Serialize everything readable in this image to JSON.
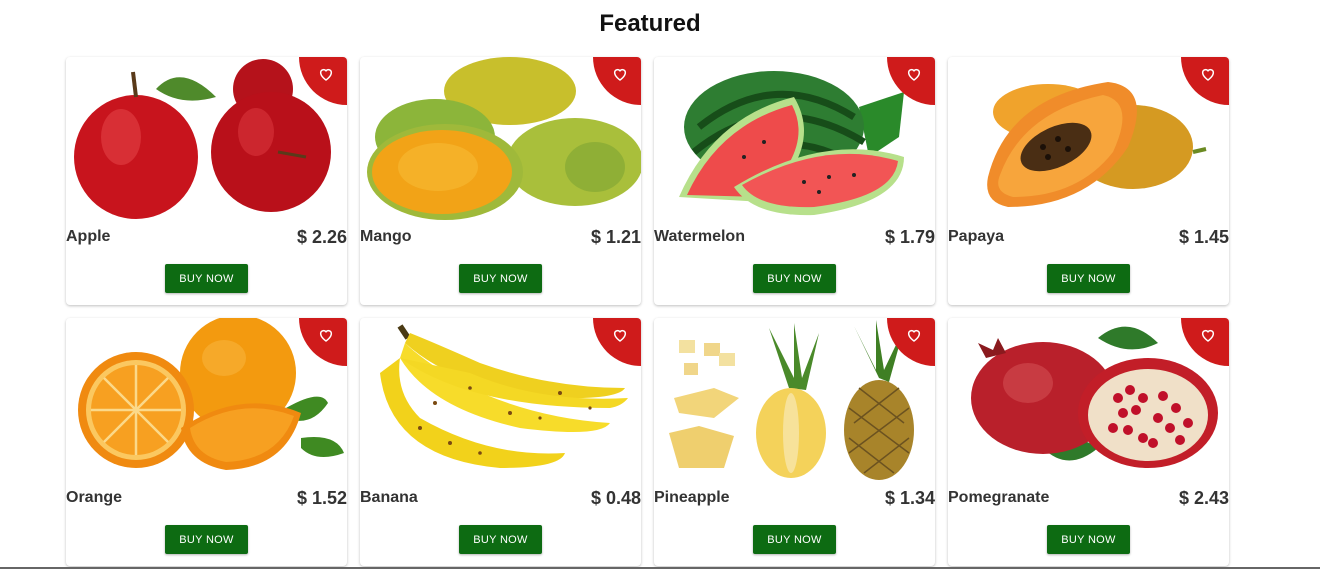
{
  "header": {
    "title": "Featured"
  },
  "products": [
    {
      "name": "Apple",
      "price": "$ 2.26",
      "buy_label": "BUY NOW",
      "image_icon": "apple-image"
    },
    {
      "name": "Mango",
      "price": "$ 1.21",
      "buy_label": "BUY NOW",
      "image_icon": "mango-image"
    },
    {
      "name": "Watermelon",
      "price": "$ 1.79",
      "buy_label": "BUY NOW",
      "image_icon": "watermelon-image"
    },
    {
      "name": "Papaya",
      "price": "$ 1.45",
      "buy_label": "BUY NOW",
      "image_icon": "papaya-image"
    },
    {
      "name": "Orange",
      "price": "$ 1.52",
      "buy_label": "BUY NOW",
      "image_icon": "orange-image"
    },
    {
      "name": "Banana",
      "price": "$ 0.48",
      "buy_label": "BUY NOW",
      "image_icon": "banana-image"
    },
    {
      "name": "Pineapple",
      "price": "$ 1.34",
      "buy_label": "BUY NOW",
      "image_icon": "pineapple-image"
    },
    {
      "name": "Pomegranate",
      "price": "$ 2.43",
      "buy_label": "BUY NOW",
      "image_icon": "pomegranate-image"
    }
  ],
  "colors": {
    "favorite_badge": "#cf1b1b",
    "buy_button": "#0d6b12",
    "text": "#333333"
  }
}
